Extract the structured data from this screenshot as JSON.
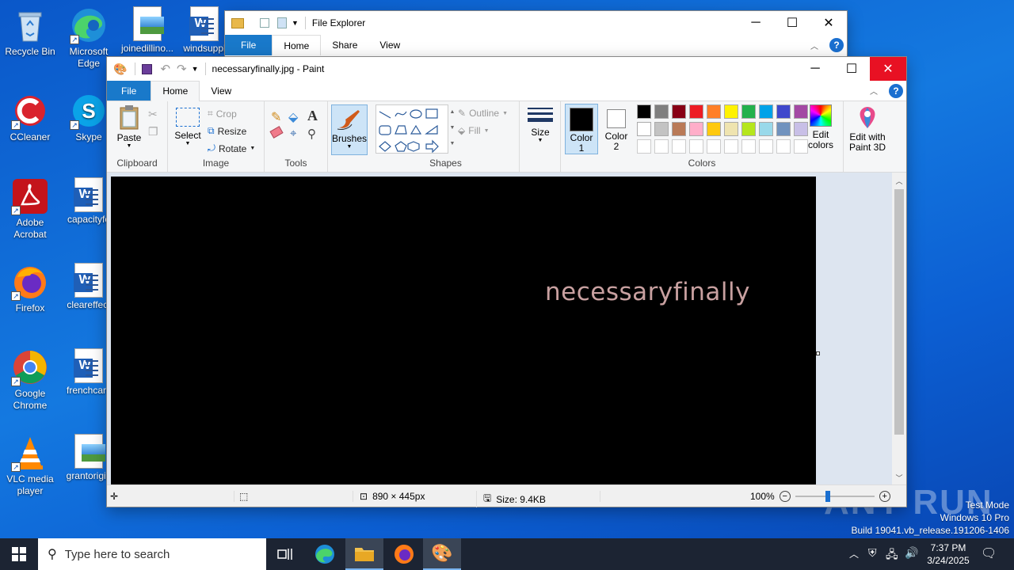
{
  "desktop": {
    "icons": [
      {
        "label": "Recycle Bin"
      },
      {
        "label": "Microsoft Edge"
      },
      {
        "label": "joinedillino..."
      },
      {
        "label": "windsuppl"
      },
      {
        "label": "CCleaner"
      },
      {
        "label": "Skype"
      },
      {
        "label": "Adobe Acrobat"
      },
      {
        "label": "capacityfo"
      },
      {
        "label": "Firefox"
      },
      {
        "label": "cleareffect"
      },
      {
        "label": "Google Chrome"
      },
      {
        "label": "frenchcars"
      },
      {
        "label": "VLC media player"
      },
      {
        "label": "grantorigin"
      }
    ],
    "watermark": {
      "brand": "ANY RUN",
      "line1": "Test Mode",
      "line2": "Windows 10 Pro",
      "line3": "Build 19041.vb_release.191206-1406"
    }
  },
  "explorer": {
    "title": "File Explorer",
    "tabs": [
      "File",
      "Home",
      "Share",
      "View"
    ]
  },
  "paint": {
    "title": "necessaryfinally.jpg - Paint",
    "tabs": [
      "File",
      "Home",
      "View"
    ],
    "ribbon": {
      "clipboard": {
        "paste": "Paste",
        "group": "Clipboard"
      },
      "image": {
        "select": "Select",
        "crop": "Crop",
        "resize": "Resize",
        "rotate": "Rotate",
        "group": "Image"
      },
      "tools": {
        "group": "Tools"
      },
      "brushes": "Brushes",
      "shapes": {
        "outline": "Outline",
        "fill": "Fill",
        "group": "Shapes"
      },
      "size": "Size",
      "color1": "Color 1",
      "color2": "Color 2",
      "colors_group": "Colors",
      "edit_colors": "Edit colors",
      "paint3d": "Edit with Paint 3D"
    },
    "palette_row1": [
      "#000000",
      "#7f7f7f",
      "#880015",
      "#ed1c24",
      "#ff7f27",
      "#fff200",
      "#22b14c",
      "#00a2e8",
      "#3f48cc",
      "#a349a4"
    ],
    "palette_row2": [
      "#ffffff",
      "#c3c3c3",
      "#b97a57",
      "#ffaec9",
      "#ffc90e",
      "#efe4b0",
      "#b5e61d",
      "#99d9ea",
      "#7092be",
      "#c8bfe7"
    ],
    "canvas_text": "necessaryfinally",
    "canvas_text_color": "#c8a0a0",
    "status": {
      "dimensions": "890 × 445px",
      "size": "Size: 9.4KB",
      "zoom": "100%"
    }
  },
  "taskbar": {
    "search_placeholder": "Type here to search",
    "time": "7:37 PM",
    "date": "3/24/2025"
  }
}
